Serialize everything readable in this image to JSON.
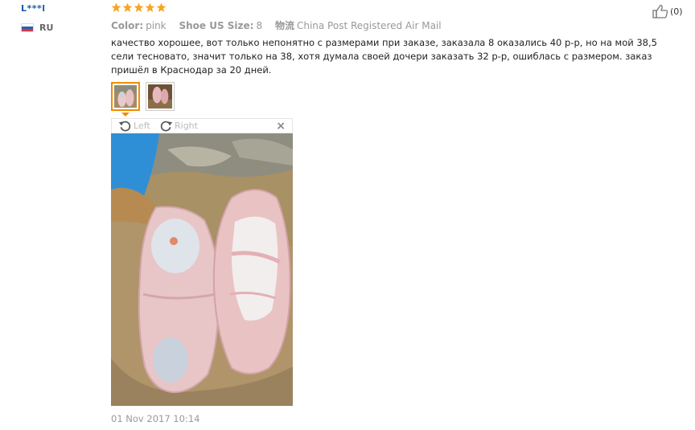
{
  "user": {
    "name": "L***l",
    "country": "RU"
  },
  "rating": {
    "stars": 5,
    "color": "#f5a623"
  },
  "attributes": [
    {
      "key": "Color:",
      "value": "pink"
    },
    {
      "key": "Shoe US Size:",
      "value": "8"
    },
    {
      "key": "物流",
      "value": "China Post Registered Air Mail"
    }
  ],
  "review": {
    "text": "качество хорошее, вот только непонятно с размерами при заказе, заказала 8 оказались 40 р-р, но на мой 38,5 сели тесновато, значит только на 38, хотя думала своей дочери заказать 32 р-р, ошиблась с размером. заказ пришёл в Краснодар за 20 дней."
  },
  "viewer": {
    "rotate_left": "Left",
    "rotate_right": "Right",
    "close": "×"
  },
  "date": "01 Nov 2017 10:14",
  "helpful": {
    "count": "(0)"
  },
  "colors": {
    "accent": "#f08c00",
    "link": "#1a5ea8"
  }
}
